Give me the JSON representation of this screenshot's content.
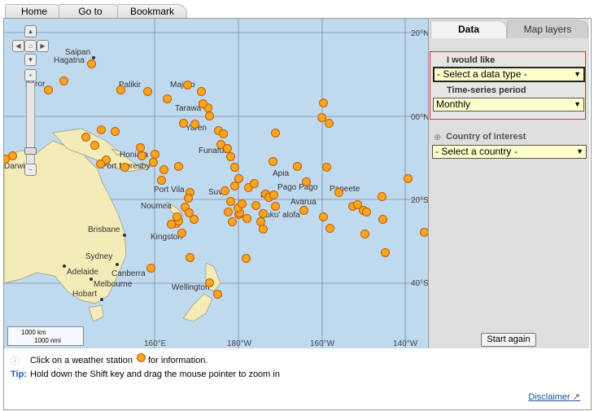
{
  "top_tabs": [
    "Home",
    "Go to",
    "Bookmark"
  ],
  "map": {
    "lat_labels": [
      "20°N",
      "00°N",
      "20°S",
      "40°S"
    ],
    "lon_labels": [
      "160°E",
      "180°W",
      "160°W",
      "140°W"
    ],
    "place_labels": [
      "Saipan",
      "Hagatna",
      "Koror",
      "Palikir",
      "Majuro",
      "Tarawa",
      "Yaren",
      "Honiara",
      "Port Moresby",
      "Funafuti",
      "Apia",
      "Pago Pago",
      "Papeete",
      "Port Vila",
      "Suva",
      "Nofi",
      "Avarua",
      "Noumea",
      "Nuku' alofa",
      "Darwin",
      "Brisbane",
      "Kingston",
      "Sydney",
      "Canberra",
      "Adelaide",
      "Melbourne",
      "Hobart",
      "Wellington"
    ],
    "scale_km": "1000 km",
    "scale_nmi": "1000 nmi"
  },
  "panel": {
    "tab_data": "Data",
    "tab_layers": "Map layers",
    "i_would_like_label": "I would like",
    "data_type_value": "- Select a data type -",
    "period_label": "Time-series period",
    "period_value": "Monthly",
    "country_label": "Country of interest",
    "country_value": "- Select a country -",
    "start_again": "Start again"
  },
  "info": {
    "line1_before": "Click on a weather station",
    "line1_after": "for information.",
    "tip_label": "Tip:",
    "tip_text": "Hold down the Shift key and drag the mouse pointer to zoom in",
    "disclaimer": "Disclaimer"
  },
  "colors": {
    "ocean": "#bfd9ef",
    "land": "#f3ebb8",
    "station": "#f5a623",
    "accent_border": "#dd3333"
  }
}
